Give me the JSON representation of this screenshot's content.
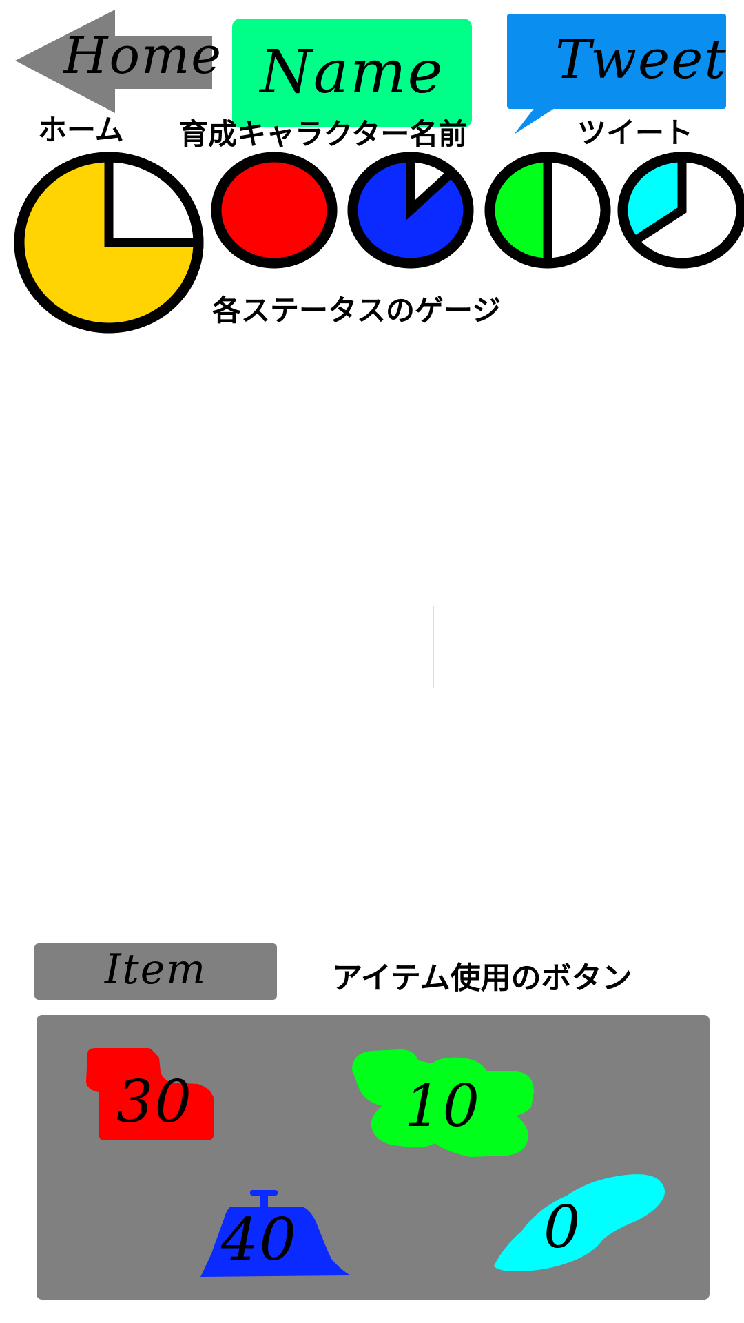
{
  "header": {
    "home": {
      "label": "Home",
      "caption": "ホーム",
      "color": "#808080",
      "icon": "arrow-left-icon"
    },
    "name": {
      "label": "Name",
      "caption": "育成キャラクター名前",
      "color": "#00ff88"
    },
    "tweet": {
      "label": "Tweet",
      "caption": "ツイート",
      "color": "#0a8ff0",
      "icon": "speech-bubble-icon"
    }
  },
  "status": {
    "caption": "各ステータスのゲージ",
    "gauges": [
      {
        "name": "yellow",
        "color": "#ffd400",
        "fill": 0.75
      },
      {
        "name": "red",
        "color": "#ff0000",
        "fill": 1.0
      },
      {
        "name": "blue",
        "color": "#0a2aff",
        "fill": 0.875
      },
      {
        "name": "green",
        "color": "#00ff1a",
        "fill": 0.5
      },
      {
        "name": "cyan",
        "color": "#00ffff",
        "fill": 0.35
      }
    ]
  },
  "items": {
    "button_label": "Item",
    "caption": "アイテム使用のボタン",
    "list": [
      {
        "id": "red",
        "count": "30",
        "color": "#ff0000"
      },
      {
        "id": "green",
        "count": "10",
        "color": "#00ff1a"
      },
      {
        "id": "blue",
        "count": "40",
        "color": "#0a2aff"
      },
      {
        "id": "cyan",
        "count": "0",
        "color": "#00ffff"
      }
    ]
  }
}
